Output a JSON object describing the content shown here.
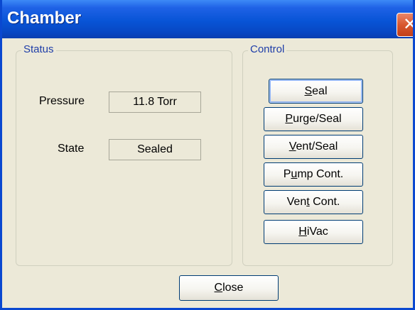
{
  "window": {
    "title": "Chamber"
  },
  "status": {
    "legend": "Status",
    "pressure_label": "Pressure",
    "pressure_value": "11.8 Torr",
    "state_label": "State",
    "state_value": "Sealed"
  },
  "control": {
    "legend": "Control",
    "buttons": [
      {
        "pre": "",
        "acc": "S",
        "post": "eal"
      },
      {
        "pre": "",
        "acc": "P",
        "post": "urge/Seal"
      },
      {
        "pre": "",
        "acc": "V",
        "post": "ent/Seal"
      },
      {
        "pre": "P",
        "acc": "u",
        "post": "mp Cont."
      },
      {
        "pre": "Ven",
        "acc": "t",
        "post": " Cont."
      },
      {
        "pre": "",
        "acc": "H",
        "post": "iVac"
      }
    ]
  },
  "footer": {
    "close_pre": "",
    "close_acc": "C",
    "close_post": "lose"
  }
}
